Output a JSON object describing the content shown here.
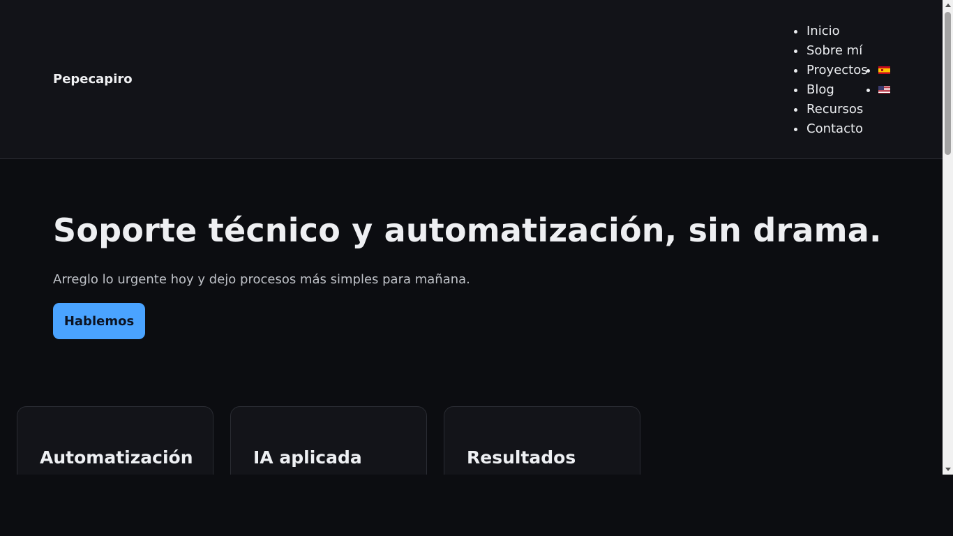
{
  "site": {
    "brand": "Pepecapiro"
  },
  "nav": {
    "items": [
      {
        "label": "Inicio"
      },
      {
        "label": "Sobre mí"
      },
      {
        "label": "Proyectos"
      },
      {
        "label": "Blog"
      },
      {
        "label": "Recursos"
      },
      {
        "label": "Contacto"
      }
    ],
    "languages": [
      {
        "icon": "spain-flag-icon"
      },
      {
        "icon": "usa-flag-icon"
      }
    ]
  },
  "hero": {
    "title": "Soporte técnico y automatización, sin drama.",
    "subtitle": "Arreglo lo urgente hoy y dejo procesos más simples para mañana.",
    "cta_label": "Hablemos"
  },
  "cards": [
    {
      "title": "Automatización"
    },
    {
      "title": "IA aplicada"
    },
    {
      "title": "Resultados"
    }
  ],
  "colors": {
    "background": "#0c0d11",
    "header": "#121318",
    "accent": "#4aa3ff"
  }
}
